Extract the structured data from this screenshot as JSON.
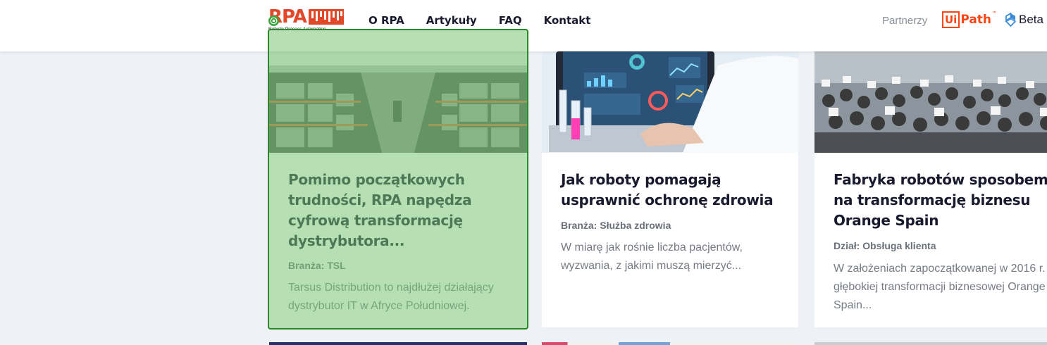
{
  "header": {
    "logo_text": "RPA",
    "logo_subtitle": "Robotic Process Automation",
    "nav": [
      "O RPA",
      "Artykuły",
      "FAQ",
      "Kontakt"
    ],
    "partners_label": "Partnerzy",
    "uipath": {
      "ui": "Ui",
      "path": "Path",
      "tm": "™"
    },
    "beta_label": "Beta"
  },
  "cards": [
    {
      "title": "Pomimo początkowych trudności, RPA napędza cyfrową transformację dystrybutora...",
      "meta": "Branża: TSL",
      "excerpt": "Tarsus Distribution to najdłużej działający dystrybutor IT w Afryce Południowej."
    },
    {
      "title": "Jak roboty pomagają usprawnić ochronę zdrowia",
      "meta": "Branża: Służba zdrowia",
      "excerpt": "W miarę jak rośnie liczba pacjentów, wyzwania, z jakimi muszą mierzyć..."
    },
    {
      "title": "Fabryka robotów sposobem na transformację biznesu Orange Spain",
      "meta": "Dział: Obsługa klienta",
      "excerpt": "W założeniach zapoczątkowanej w 2016 r. głębokiej transformacji biznesowej Orange Spain..."
    }
  ],
  "colors": {
    "brand_red": "#e2472a",
    "uipath_orange": "#fa4616",
    "highlight_green": "#7ac476",
    "text_dark": "#1a1a2e",
    "text_muted": "#767b84"
  },
  "icons": {
    "highlight_marker": "target-icon",
    "beta_logo": "beta-logo-icon"
  }
}
